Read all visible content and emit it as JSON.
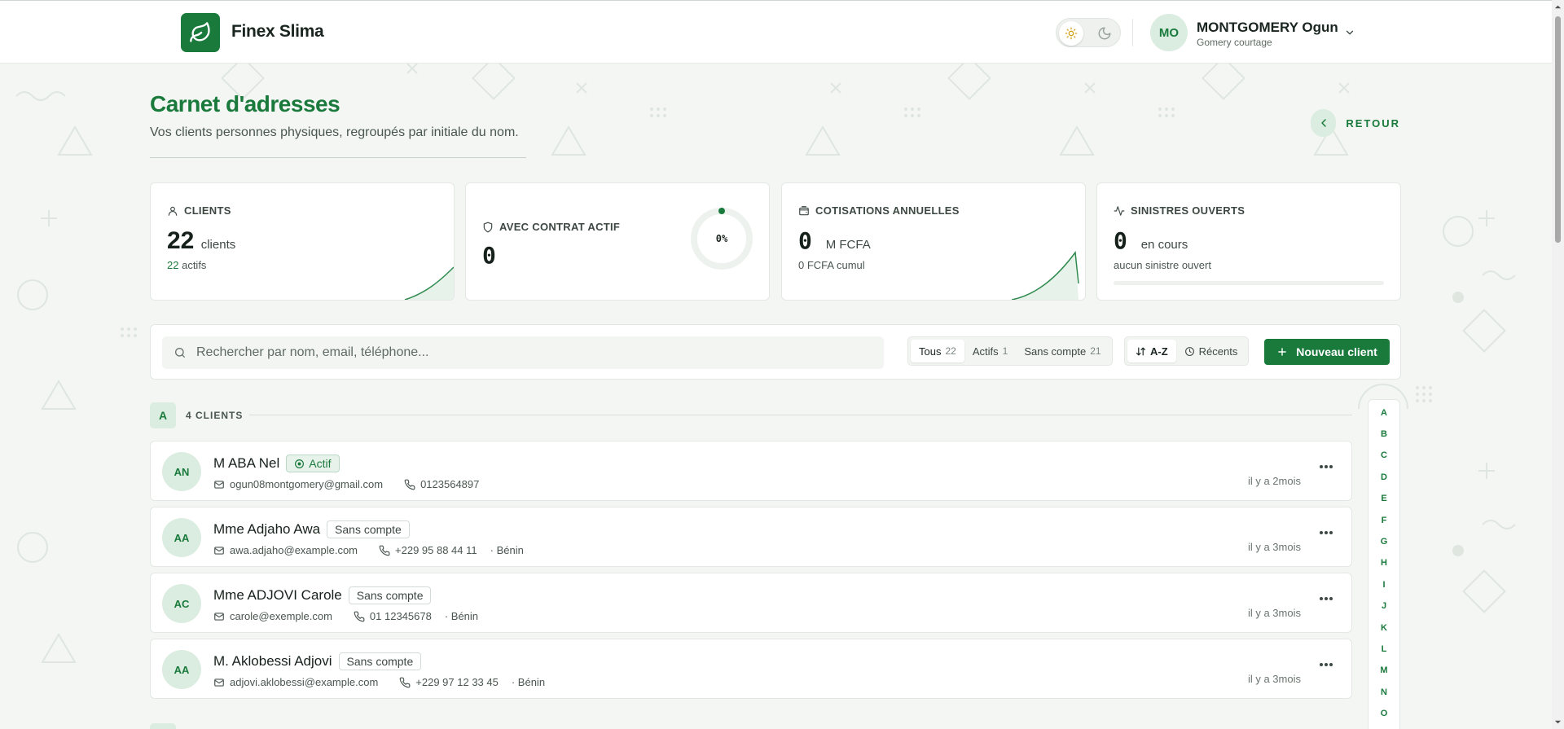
{
  "app": {
    "brand": "Finex Slima"
  },
  "user": {
    "initials": "MO",
    "name": "MONTGOMERY Ogun",
    "org": "Gomery courtage"
  },
  "page": {
    "title": "Carnet d'adresses",
    "subtitle": "Vos clients personnes physiques, regroupés par initiale du nom.",
    "back_label": "RETOUR"
  },
  "stats": {
    "clients": {
      "label": "CLIENTS",
      "value": "22",
      "unit": "clients",
      "sub_count": "22",
      "sub_text": "actifs"
    },
    "contract": {
      "label": "AVEC CONTRAT ACTIF",
      "value": "0",
      "ring_label": "0%",
      "ring_percent": 0
    },
    "cotisations": {
      "label": "COTISATIONS ANNUELLES",
      "value": "0",
      "unit": "M FCFA",
      "sub_text": "0 FCFA cumul"
    },
    "sinistres": {
      "label": "SINISTRES OUVERTS",
      "value": "0",
      "unit": "en cours",
      "sub_text": "aucun sinistre ouvert"
    }
  },
  "toolbar": {
    "search_placeholder": "Rechercher par nom, email, téléphone...",
    "filters": [
      {
        "label": "Tous",
        "count": "22",
        "active": true
      },
      {
        "label": "Actifs",
        "count": "1",
        "active": false
      },
      {
        "label": "Sans compte",
        "count": "21",
        "active": false
      }
    ],
    "sort": [
      {
        "label": "A-Z",
        "icon": "sort-icon",
        "active": true
      },
      {
        "label": "Récents",
        "icon": "clock-icon",
        "active": false
      }
    ],
    "new_button": "Nouveau client"
  },
  "group": {
    "letter": "A",
    "count_label": "4 CLIENTS"
  },
  "clients": [
    {
      "initials": "AN",
      "name": "M ABA Nel",
      "badge": "Actif",
      "badge_active": true,
      "email": "ogun08montgomery@gmail.com",
      "phone": "0123564897",
      "country": "",
      "time": "il y a 2mois"
    },
    {
      "initials": "AA",
      "name": "Mme Adjaho Awa",
      "badge": "Sans compte",
      "badge_active": false,
      "email": "awa.adjaho@example.com",
      "phone": "+229 95 88 44 11",
      "country": "· Bénin",
      "time": "il y a 3mois"
    },
    {
      "initials": "AC",
      "name": "Mme ADJOVI Carole",
      "badge": "Sans compte",
      "badge_active": false,
      "email": "carole@exemple.com",
      "phone": "01 12345678",
      "country": "· Bénin",
      "time": "il y a 3mois"
    },
    {
      "initials": "AA",
      "name": "M. Aklobessi Adjovi",
      "badge": "Sans compte",
      "badge_active": false,
      "email": "adjovi.aklobessi@example.com",
      "phone": "+229 97 12 33 45",
      "country": "· Bénin",
      "time": "il y a 3mois"
    }
  ],
  "alphabet": [
    "A",
    "B",
    "C",
    "D",
    "E",
    "F",
    "G",
    "H",
    "I",
    "J",
    "K",
    "L",
    "M",
    "N",
    "O"
  ],
  "colors": {
    "brand": "#1a7a3c",
    "brand_light": "#dbece0",
    "background": "#f3f6f3"
  }
}
